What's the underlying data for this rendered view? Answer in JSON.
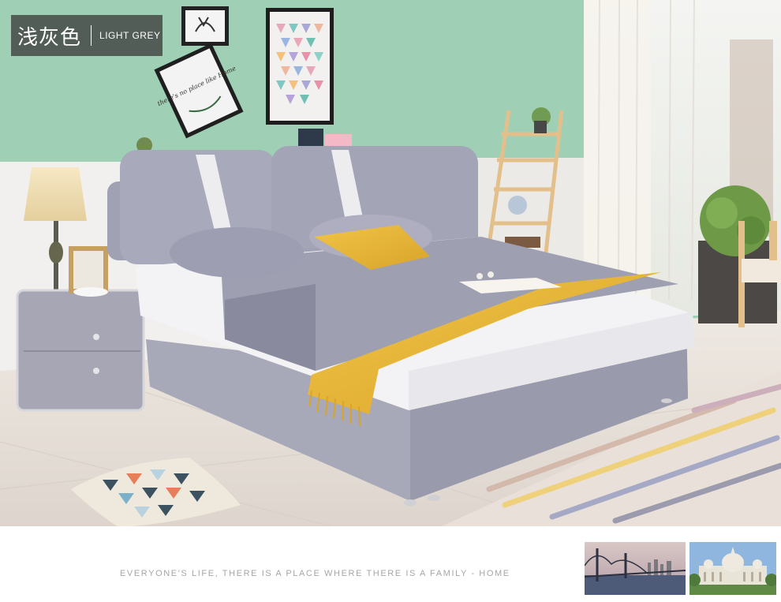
{
  "color_tag": {
    "chinese_name": "浅灰色",
    "english_name": "LIGHT GREY"
  },
  "slogan": "EVERYONE'S LIFE, THERE IS A PLACE WHERE THERE IS A FAMILY - HOME",
  "frame_script_text": "there's no place like Home",
  "colors": {
    "wall_green": "#9fcfb4",
    "bed_grey": "#a7a8b8",
    "throw_yellow": "#e6b43a",
    "floor": "#e8e2dc",
    "overlay": "#3c3c3c"
  }
}
